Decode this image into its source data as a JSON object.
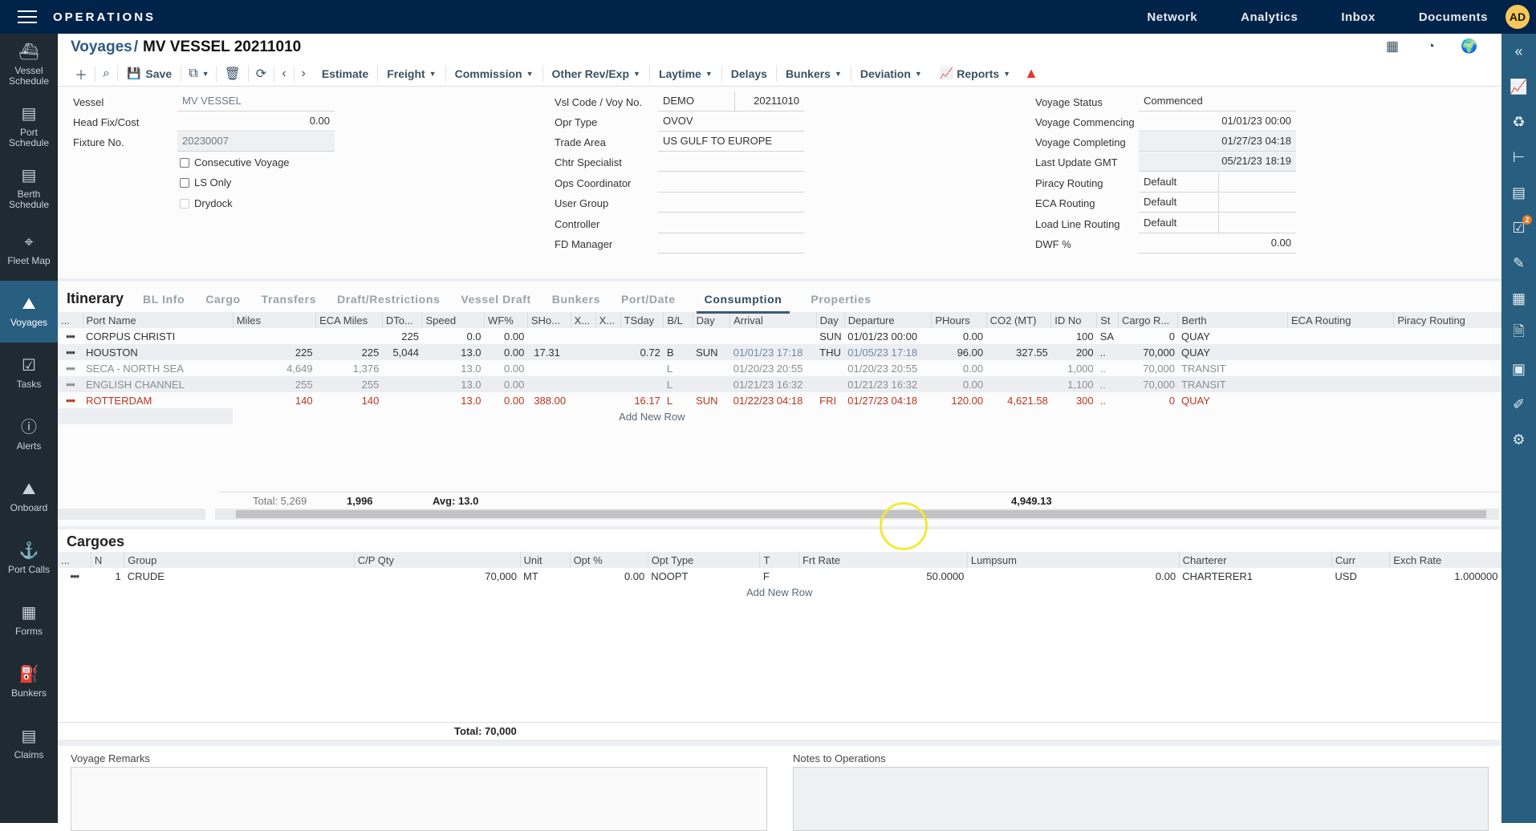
{
  "app": {
    "title": "OPERATIONS",
    "user_initials": "AD"
  },
  "topnav": [
    "Network",
    "Analytics",
    "Inbox",
    "Documents"
  ],
  "leftnav": [
    {
      "label": "Vessel Schedule",
      "icon": "ship-icon",
      "glyph": "⛴"
    },
    {
      "label": "Port Schedule",
      "icon": "gantt-icon",
      "glyph": "▤"
    },
    {
      "label": "Berth Schedule",
      "icon": "gantt-icon",
      "glyph": "▤"
    },
    {
      "label": "Fleet Map",
      "icon": "map-pin-icon",
      "glyph": "⌖"
    },
    {
      "label": "Voyages",
      "icon": "voyage-icon",
      "glyph": "⛰",
      "active": true
    },
    {
      "label": "Tasks",
      "icon": "checklist-icon",
      "glyph": "☑"
    },
    {
      "label": "Alerts",
      "icon": "alert-circle-icon",
      "glyph": "ⓘ"
    },
    {
      "label": "Onboard",
      "icon": "onboard-icon",
      "glyph": "⛰"
    },
    {
      "label": "Port Calls",
      "icon": "anchor-icon",
      "glyph": "⚓"
    },
    {
      "label": "Forms",
      "icon": "forms-icon",
      "glyph": "▦"
    },
    {
      "label": "Bunkers",
      "icon": "fuel-pump-icon",
      "glyph": "⛽"
    },
    {
      "label": "Claims",
      "icon": "claims-icon",
      "glyph": "▤"
    }
  ],
  "rightnav": [
    {
      "icon": "collapse-icon",
      "glyph": "«"
    },
    {
      "icon": "chart-icon",
      "glyph": "📈"
    },
    {
      "icon": "emissions-icon",
      "glyph": "♻"
    },
    {
      "icon": "hierarchy-icon",
      "glyph": "⊢"
    },
    {
      "icon": "ledger-icon",
      "glyph": "▤"
    },
    {
      "icon": "tasks-icon",
      "glyph": "☑",
      "badge": "2"
    },
    {
      "icon": "edit-cycle-icon",
      "glyph": "✎"
    },
    {
      "icon": "forms-icon",
      "glyph": "▦"
    },
    {
      "icon": "document-icon",
      "glyph": "🗎"
    },
    {
      "icon": "contact-icon",
      "glyph": "▣"
    },
    {
      "icon": "notebook-icon",
      "glyph": "✐"
    },
    {
      "icon": "settings-icon",
      "glyph": "⚙"
    }
  ],
  "breadcrumb": {
    "parent": "Voyages",
    "separator": "/",
    "title": "MV VESSEL 20211010"
  },
  "toolbar": {
    "save": "Save",
    "items": [
      "Estimate",
      "Freight",
      "Commission",
      "Other Rev/Exp",
      "Laytime",
      "Delays",
      "Bunkers",
      "Deviation",
      "Reports"
    ]
  },
  "header": {
    "col1": {
      "vessel_label": "Vessel",
      "vessel": "MV VESSEL",
      "headfix_label": "Head Fix/Cost",
      "headfix": "0.00",
      "fixture_label": "Fixture No.",
      "fixture": "20230007",
      "consecutive_label": "Consecutive Voyage",
      "lsonly_label": "LS Only",
      "drydock_label": "Drydock"
    },
    "col2": {
      "vslcode_label": "Vsl Code / Voy No.",
      "vslcode": "DEMO",
      "voyno": "20211010",
      "oprtype_label": "Opr Type",
      "oprtype": "OVOV",
      "tradearea_label": "Trade Area",
      "tradearea": "US GULF TO EUROPE",
      "chtr_label": "Chtr Specialist",
      "chtr": "",
      "ops_label": "Ops Coordinator",
      "ops": "",
      "usergroup_label": "User Group",
      "usergroup": "",
      "controller_label": "Controller",
      "controller": "",
      "fd_label": "FD Manager",
      "fd": ""
    },
    "col3": {
      "status_label": "Voyage Status",
      "status": "Commenced",
      "commencing_label": "Voyage Commencing",
      "commencing": "01/01/23 00:00",
      "completing_label": "Voyage Completing",
      "completing": "01/27/23 04:18",
      "lastupdate_label": "Last Update GMT",
      "lastupdate": "05/21/23 18:19",
      "piracy_label": "Piracy Routing",
      "piracy": "Default",
      "eca_label": "ECA Routing",
      "eca": "Default",
      "loadline_label": "Load Line Routing",
      "loadline": "Default",
      "dwf_label": "DWF %",
      "dwf": "0.00"
    }
  },
  "itinerary": {
    "title": "Itinerary",
    "tabs": [
      "BL Info",
      "Cargo",
      "Transfers",
      "Draft/Restrictions",
      "Vessel Draft",
      "Bunkers",
      "Port/Date",
      "Consumption",
      "Properties"
    ],
    "active_tab": "Consumption",
    "columns": [
      "...",
      "Port Name",
      "Miles",
      "ECA Miles",
      "DTo...",
      "Speed",
      "WF%",
      "SHo...",
      "X...",
      "X...",
      "TSday",
      "B/L",
      "Day",
      "Arrival",
      "Day",
      "Departure",
      "PHours",
      "CO2 (MT)",
      "ID No",
      "St",
      "Cargo R...",
      "Berth",
      "ECA Routing",
      "Piracy Routing"
    ],
    "rows": [
      {
        "style": "normal",
        "port": "CORPUS CHRISTI",
        "miles": "",
        "eca": "",
        "dto": "225",
        "speed": "0.0",
        "wf": "0.00",
        "sho": "",
        "x1": "",
        "x2": "",
        "tsday": "",
        "bl": "",
        "day1": "",
        "arrival": "",
        "day2": "SUN",
        "departure": "01/01/23 00:00",
        "phours": "0.00",
        "co2": "",
        "idno": "100",
        "st": "SA",
        "cargo": "0",
        "berth": "QUAY",
        "ecar": "",
        "piracy": ""
      },
      {
        "style": "normal",
        "port": "HOUSTON",
        "miles": "225",
        "eca": "225",
        "dto": "5,044",
        "speed": "13.0",
        "wf": "0.00",
        "sho": "17.31",
        "x1": "",
        "x2": "",
        "tsday": "0.72",
        "bl": "B",
        "day1": "SUN",
        "arrival": "01/01/23 17:18",
        "day2": "THU",
        "departure": "01/05/23 17:18",
        "phours": "96.00",
        "co2": "327.55",
        "idno": "200",
        "st": "..",
        "cargo": "70,000",
        "berth": "QUAY",
        "ecar": "",
        "piracy": ""
      },
      {
        "style": "muted",
        "port": "SECA - NORTH SEA",
        "miles": "4,649",
        "eca": "1,376",
        "dto": "",
        "speed": "13.0",
        "wf": "0.00",
        "sho": "",
        "x1": "",
        "x2": "",
        "tsday": "",
        "bl": "L",
        "day1": "",
        "arrival": "01/20/23 20:55",
        "day2": "",
        "departure": "01/20/23 20:55",
        "phours": "0.00",
        "co2": "",
        "idno": "1,000",
        "st": "..",
        "cargo": "70,000",
        "berth": "TRANSIT",
        "ecar": "",
        "piracy": ""
      },
      {
        "style": "muted",
        "port": "ENGLISH CHANNEL",
        "miles": "255",
        "eca": "255",
        "dto": "",
        "speed": "13.0",
        "wf": "0.00",
        "sho": "",
        "x1": "",
        "x2": "",
        "tsday": "",
        "bl": "L",
        "day1": "",
        "arrival": "01/21/23 16:32",
        "day2": "",
        "departure": "01/21/23 16:32",
        "phours": "0.00",
        "co2": "",
        "idno": "1,100",
        "st": "..",
        "cargo": "70,000",
        "berth": "TRANSIT",
        "ecar": "",
        "piracy": ""
      },
      {
        "style": "red",
        "port": "ROTTERDAM",
        "miles": "140",
        "eca": "140",
        "dto": "",
        "speed": "13.0",
        "wf": "0.00",
        "sho": "388.00",
        "x1": "",
        "x2": "",
        "tsday": "16.17",
        "bl": "L",
        "day1": "SUN",
        "arrival": "01/22/23 04:18",
        "day2": "FRI",
        "departure": "01/27/23 04:18",
        "phours": "120.00",
        "co2": "4,621.58",
        "idno": "300",
        "st": "..",
        "cargo": "0",
        "berth": "QUAY",
        "ecar": "",
        "piracy": ""
      }
    ],
    "add_row": "Add New Row",
    "totals": {
      "miles": "Total: 5,269",
      "eca": "1,996",
      "speed": "Avg: 13.0",
      "co2": "4,949.13"
    }
  },
  "cargoes": {
    "title": "Cargoes",
    "columns": [
      "...",
      "N",
      "Group",
      "C/P Qty",
      "Unit",
      "Opt %",
      "Opt Type",
      "T",
      "Frt Rate",
      "Lumpsum",
      "Charterer",
      "Curr",
      "Exch Rate"
    ],
    "rows": [
      {
        "n": "1",
        "group": "CRUDE",
        "qty": "70,000",
        "unit": "MT",
        "opt": "0.00",
        "opttype": "NOOPT",
        "t": "F",
        "frt": "50.0000",
        "lumpsum": "0.00",
        "charterer": "CHARTERER1",
        "curr": "USD",
        "exch": "1.000000"
      }
    ],
    "add_row": "Add New Row",
    "total": "Total: 70,000"
  },
  "remarks": {
    "voyage_label": "Voyage Remarks",
    "voyage_value": "",
    "notes_label": "Notes to Operations",
    "notes_value": ""
  },
  "colors": {
    "topbar": "#00234a",
    "leftnav": "#202a33",
    "active": "#285e7f",
    "warning": "#e03a2f",
    "red_row": "#b8361f",
    "avatar": "#f6c85a"
  }
}
